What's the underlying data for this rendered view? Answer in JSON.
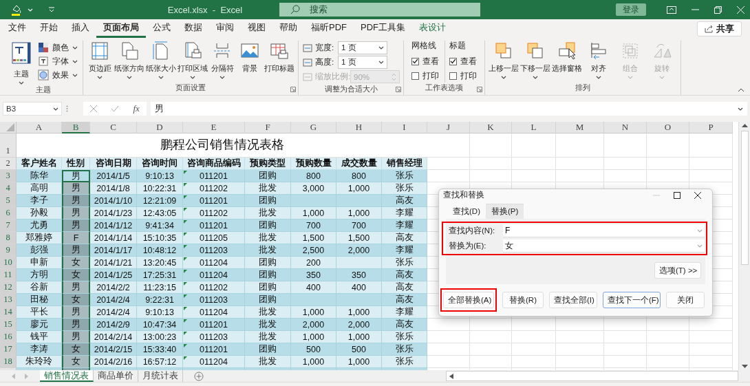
{
  "title_bar": {
    "title": "Excel.xlsx  -  Excel",
    "search_placeholder": "搜索",
    "sign_in": "登录"
  },
  "ribbon_tabs": [
    {
      "label": "文件",
      "selected": false,
      "contextual": false
    },
    {
      "label": "开始",
      "selected": false,
      "contextual": false
    },
    {
      "label": "插入",
      "selected": false,
      "contextual": false
    },
    {
      "label": "页面布局",
      "selected": true,
      "contextual": false
    },
    {
      "label": "公式",
      "selected": false,
      "contextual": false
    },
    {
      "label": "数据",
      "selected": false,
      "contextual": false
    },
    {
      "label": "审阅",
      "selected": false,
      "contextual": false
    },
    {
      "label": "视图",
      "selected": false,
      "contextual": false
    },
    {
      "label": "帮助",
      "selected": false,
      "contextual": false
    },
    {
      "label": "福昕PDF",
      "selected": false,
      "contextual": false
    },
    {
      "label": "PDF工具集",
      "selected": false,
      "contextual": false
    },
    {
      "label": "表设计",
      "selected": false,
      "contextual": true
    }
  ],
  "share": "共享",
  "ribbon_groups": [
    {
      "kind": "theme",
      "title": "主题",
      "launcher": false,
      "big": "主题",
      "small": [
        {
          "label": "颜色"
        },
        {
          "label": "字体"
        },
        {
          "label": "效果"
        }
      ]
    },
    {
      "kind": "page_setup",
      "title": "页面设置",
      "launcher": true,
      "buttons": [
        {
          "label": "页边距",
          "dropdown": true,
          "disabled": false
        },
        {
          "label": "纸张方向",
          "dropdown": true,
          "disabled": false
        },
        {
          "label": "纸张大小",
          "dropdown": true,
          "disabled": false
        },
        {
          "label": "打印区域",
          "dropdown": true,
          "disabled": false
        },
        {
          "label": "分隔符",
          "dropdown": true,
          "disabled": false
        },
        {
          "label": "背景",
          "dropdown": false,
          "disabled": false
        },
        {
          "label": "打印标题",
          "dropdown": false,
          "disabled": false
        }
      ]
    },
    {
      "kind": "scale",
      "title": "调整为合适大小",
      "launcher": true,
      "fields": [
        {
          "label": "宽度:",
          "value": "1 页",
          "disabled": false
        },
        {
          "label": "高度:",
          "value": "1 页",
          "disabled": false
        },
        {
          "label": "缩放比例:",
          "value": "90%",
          "disabled": true
        }
      ]
    },
    {
      "kind": "options",
      "title": "工作表选项",
      "launcher": true,
      "columns": [
        {
          "label": "网格线",
          "options": [
            {
              "label": "查看",
              "checked": true
            },
            {
              "label": "打印",
              "checked": false
            }
          ]
        },
        {
          "label": "标题",
          "options": [
            {
              "label": "查看",
              "checked": true
            },
            {
              "label": "打印",
              "checked": false
            }
          ]
        }
      ]
    },
    {
      "kind": "arrange",
      "title": "排列",
      "launcher": false,
      "buttons": [
        {
          "label": "上移一层",
          "dropdown": true,
          "disabled": false
        },
        {
          "label": "下移一层",
          "dropdown": true,
          "disabled": false
        },
        {
          "label": "选择窗格",
          "dropdown": false,
          "disabled": false
        },
        {
          "label": "对齐",
          "dropdown": true,
          "disabled": false
        },
        {
          "label": "组合",
          "dropdown": true,
          "disabled": true
        },
        {
          "label": "旋转",
          "dropdown": true,
          "disabled": true
        }
      ]
    }
  ],
  "formula_bar": {
    "name_box": "B3",
    "function_label": "fx",
    "formula": "男"
  },
  "sheet": {
    "title_row": "1",
    "title": "鹏程公司销售情况表格",
    "columns": [
      {
        "letter": "A",
        "selected": false,
        "flagged": false
      },
      {
        "letter": "B",
        "selected": true,
        "flagged": false
      },
      {
        "letter": "C",
        "selected": false,
        "flagged": false
      },
      {
        "letter": "D",
        "selected": false,
        "flagged": false
      },
      {
        "letter": "E",
        "selected": false,
        "flagged": true
      },
      {
        "letter": "F",
        "selected": false,
        "flagged": false
      },
      {
        "letter": "G",
        "selected": false,
        "flagged": false
      },
      {
        "letter": "H",
        "selected": false,
        "flagged": false
      },
      {
        "letter": "I",
        "selected": false,
        "flagged": false
      },
      {
        "letter": "J",
        "selected": false
      },
      {
        "letter": "K",
        "selected": false
      },
      {
        "letter": "L",
        "selected": false
      },
      {
        "letter": "M",
        "selected": false
      },
      {
        "letter": "N",
        "selected": false
      },
      {
        "letter": "O",
        "selected": false
      },
      {
        "letter": "P",
        "selected": false
      }
    ],
    "header_row": {
      "number": "2",
      "cells": [
        "客户姓名",
        "性别",
        "咨询日期",
        "咨询时间",
        "咨询商品编码",
        "预购类型",
        "预购数量",
        "成交数量",
        "销售经理"
      ]
    },
    "rows": [
      {
        "number": "3",
        "selected": true,
        "active": true,
        "cells": [
          "陈华",
          "男",
          "2014/1/5",
          "9:10:13",
          "011201",
          "团购",
          "800",
          "800",
          "张乐"
        ]
      },
      {
        "number": "4",
        "selected": true,
        "active": false,
        "cells": [
          "高明",
          "男",
          "2014/1/8",
          "10:22:31",
          "011202",
          "批发",
          "3,000",
          "1,000",
          "张乐"
        ]
      },
      {
        "number": "5",
        "selected": true,
        "active": false,
        "cells": [
          "李子",
          "男",
          "2014/1/10",
          "12:21:09",
          "011201",
          "团购",
          null,
          null,
          "高友"
        ]
      },
      {
        "number": "6",
        "selected": true,
        "active": false,
        "cells": [
          "孙毅",
          "男",
          "2014/1/23",
          "12:43:05",
          "011202",
          "批发",
          "1,000",
          "1,000",
          "李耀"
        ]
      },
      {
        "number": "7",
        "selected": true,
        "active": false,
        "cells": [
          "尤勇",
          "男",
          "2014/1/12",
          "9:41:34",
          "011201",
          "团购",
          "700",
          "700",
          "李耀"
        ]
      },
      {
        "number": "8",
        "selected": true,
        "active": false,
        "cells": [
          "郑雅婷",
          "F",
          "2014/1/14",
          "15:10:35",
          "011205",
          "批发",
          "1,500",
          "1,500",
          "高友"
        ]
      },
      {
        "number": "9",
        "selected": true,
        "active": false,
        "cells": [
          "彭强",
          "男",
          "2014/1/17",
          "10:48:12",
          "011203",
          "批发",
          "2,500",
          "2,000",
          "李耀"
        ]
      },
      {
        "number": "10",
        "selected": true,
        "active": false,
        "cells": [
          "申新",
          "女",
          "2014/1/21",
          "13:20:45",
          "011204",
          "团购",
          "200",
          null,
          "张乐"
        ]
      },
      {
        "number": "11",
        "selected": true,
        "active": false,
        "cells": [
          "方明",
          "女",
          "2014/1/25",
          "17:25:31",
          "011204",
          "团购",
          "350",
          "350",
          "高友"
        ]
      },
      {
        "number": "12",
        "selected": true,
        "active": false,
        "cells": [
          "谷新",
          "男",
          "2014/2/2",
          "11:23:15",
          "011202",
          "团购",
          "400",
          "400",
          "高友"
        ]
      },
      {
        "number": "13",
        "selected": true,
        "active": false,
        "cells": [
          "田秘",
          "女",
          "2014/2/4",
          "9:22:31",
          "011203",
          "团购",
          null,
          null,
          "高友"
        ]
      },
      {
        "number": "14",
        "selected": true,
        "active": false,
        "cells": [
          "平长",
          "男",
          "2014/2/4",
          "9:10:13",
          "011204",
          "批发",
          "1,000",
          "1,000",
          "李耀"
        ]
      },
      {
        "number": "15",
        "selected": true,
        "active": false,
        "cells": [
          "廖元",
          "男",
          "2014/2/9",
          "10:47:34",
          "011201",
          "批发",
          "2,000",
          "2,000",
          "高友"
        ]
      },
      {
        "number": "16",
        "selected": true,
        "active": false,
        "cells": [
          "钱平",
          "男",
          "2014/2/14",
          "13:00:23",
          "011203",
          "批发",
          "1,000",
          "1,000",
          "张乐"
        ]
      },
      {
        "number": "17",
        "selected": true,
        "active": false,
        "cells": [
          "李涛",
          "女",
          "2014/2/15",
          "15:33:40",
          "011201",
          "团购",
          "500",
          "500",
          "张乐"
        ]
      },
      {
        "number": "18",
        "selected": true,
        "active": false,
        "cells": [
          "朱玲玲",
          "女",
          "2014/2/16",
          "16:57:12",
          "011204",
          "批发",
          "1,000",
          "1,000",
          "张乐"
        ]
      }
    ]
  },
  "sheet_tabs": [
    {
      "label": "销售情况表",
      "selected": true
    },
    {
      "label": "商品单价",
      "selected": false
    },
    {
      "label": "月统计表",
      "selected": false
    }
  ],
  "dialog": {
    "title": "查找和替换",
    "tabs": [
      {
        "label": "查找(D)",
        "selected": false
      },
      {
        "label": "替换(P)",
        "selected": true
      }
    ],
    "fields_highlighted": true,
    "fields": [
      {
        "label": "查找内容(N):",
        "value": "F"
      },
      {
        "label": "替换为(E):",
        "value": "女"
      }
    ],
    "options_button": "选项(T) >>",
    "buttons": [
      {
        "label": "全部替换(A)",
        "default": false,
        "highlighted": true
      },
      {
        "label": "替换(R)",
        "default": false,
        "highlighted": false
      },
      {
        "label": "查找全部(I)",
        "default": false,
        "highlighted": false
      },
      {
        "label": "查找下一个(F)",
        "default": true,
        "highlighted": false
      },
      {
        "label": "关闭",
        "default": false,
        "highlighted": false
      }
    ]
  }
}
